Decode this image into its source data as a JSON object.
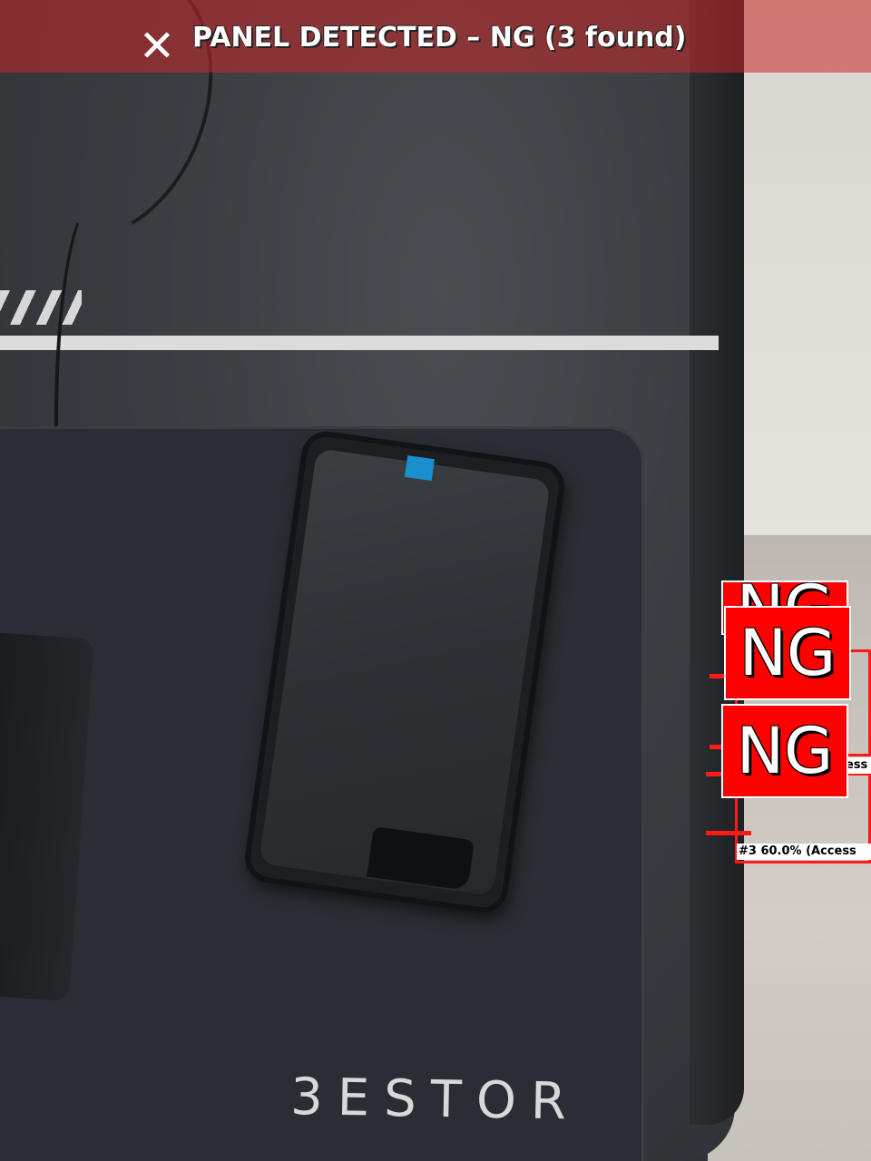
{
  "banner": {
    "close_glyph": "✕",
    "status_text": "PANEL DETECTED – NG (3 found)"
  },
  "scene": {
    "mousepad_brand": "3ESTOR"
  },
  "detections": {
    "badges": [
      {
        "label": "NG"
      },
      {
        "label": "NG"
      },
      {
        "label": "NG"
      }
    ],
    "labels": [
      {
        "text": "#3 60.0% (Access"
      },
      {
        "text": "ess"
      }
    ]
  },
  "colors": {
    "banner_bg": "#c82828",
    "ng_red": "#ff0000",
    "box_red": "#ff1a1a"
  }
}
